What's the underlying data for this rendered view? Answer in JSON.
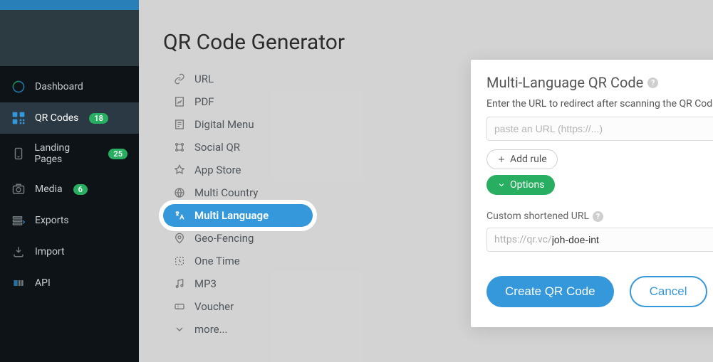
{
  "sidebar": {
    "items": [
      {
        "label": "Dashboard",
        "badge": null,
        "icon": "dashboard-icon"
      },
      {
        "label": "QR Codes",
        "badge": "18",
        "icon": "qr-icon"
      },
      {
        "label": "Landing Pages",
        "badge": "25",
        "icon": "landing-icon"
      },
      {
        "label": "Media",
        "badge": "6",
        "icon": "media-icon"
      },
      {
        "label": "Exports",
        "badge": null,
        "icon": "exports-icon"
      },
      {
        "label": "Import",
        "badge": null,
        "icon": "import-icon"
      },
      {
        "label": "API",
        "badge": null,
        "icon": "api-icon"
      }
    ],
    "active_index": 1
  },
  "page": {
    "title": "QR Code Generator"
  },
  "types": [
    {
      "label": "URL"
    },
    {
      "label": "PDF"
    },
    {
      "label": "Digital Menu"
    },
    {
      "label": "Social QR"
    },
    {
      "label": "App Store"
    },
    {
      "label": "Multi Country"
    },
    {
      "label": "Multi Language"
    },
    {
      "label": "Geo-Fencing"
    },
    {
      "label": "One Time"
    },
    {
      "label": "MP3"
    },
    {
      "label": "Voucher"
    },
    {
      "label": "more..."
    }
  ],
  "types_selected_index": 6,
  "panel": {
    "title": "Multi-Language QR Code",
    "instruction": "Enter the URL to redirect after scanning the QR Code:",
    "url_placeholder": "paste an URL (https://...)",
    "add_rule_label": "Add rule",
    "options_label": "Options",
    "custom_url_label": "Custom shortened URL",
    "url_prefix": "https://qr.vc/",
    "url_value": "joh-doe-int",
    "create_label": "Create QR Code",
    "cancel_label": "Cancel"
  }
}
